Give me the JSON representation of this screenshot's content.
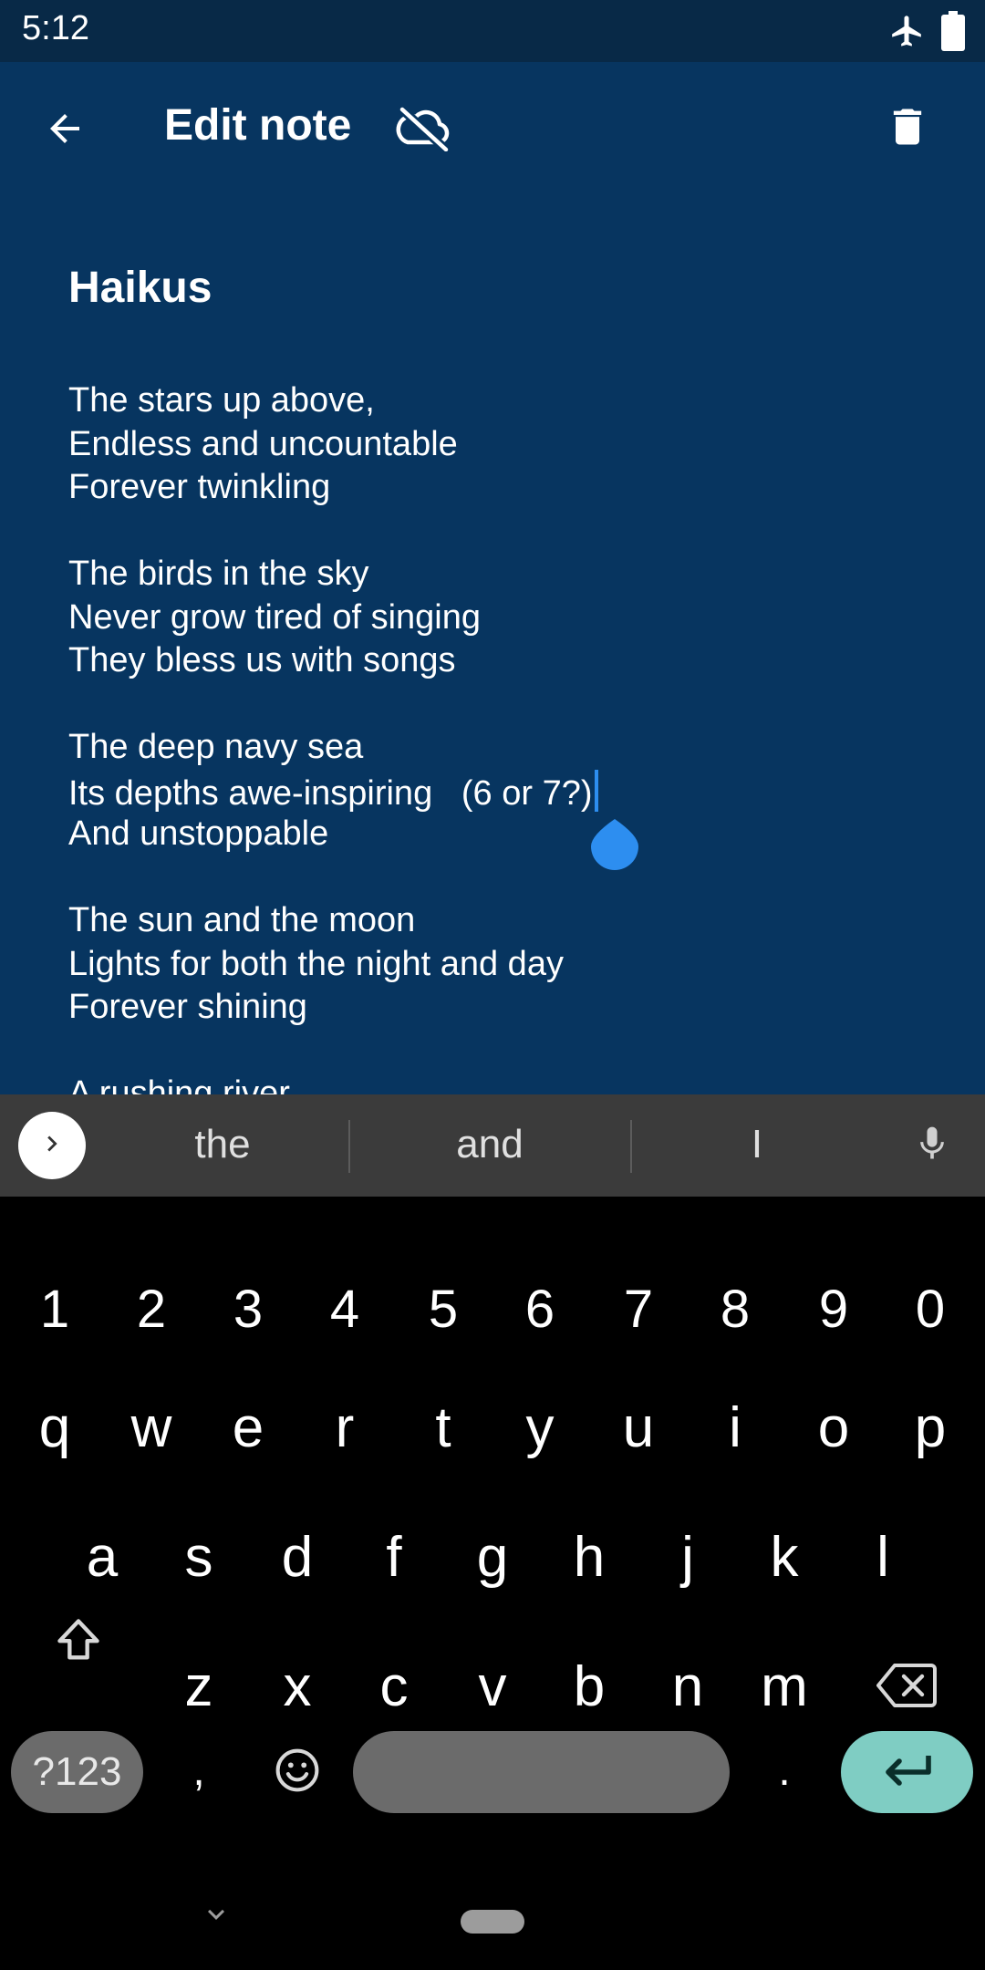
{
  "status_bar": {
    "time": "5:12",
    "icons": [
      "airplane-icon",
      "battery-icon"
    ]
  },
  "toolbar": {
    "title": "Edit note",
    "back_icon": "arrow-back-icon",
    "sync_icon": "cloud-off-icon",
    "delete_icon": "trash-icon"
  },
  "note": {
    "title": "Haikus",
    "stanzas": [
      [
        "The stars up above,",
        "Endless and uncountable",
        "Forever twinkling"
      ],
      [
        "The birds in the sky",
        "Never grow tired of singing",
        "They bless us with songs"
      ],
      [
        "The deep navy sea",
        "Its depths awe-inspiring   (6 or 7?)",
        "And unstoppable"
      ],
      [
        "The sun and the moon",
        "Lights for both the night and day",
        "Forever shining"
      ],
      [
        "A rushing river"
      ]
    ]
  },
  "suggestions": {
    "items": [
      "the",
      "and",
      "I"
    ]
  },
  "keyboard": {
    "number_row": [
      "1",
      "2",
      "3",
      "4",
      "5",
      "6",
      "7",
      "8",
      "9",
      "0"
    ],
    "row1": [
      "q",
      "w",
      "e",
      "r",
      "t",
      "y",
      "u",
      "i",
      "o",
      "p"
    ],
    "row2": [
      "a",
      "s",
      "d",
      "f",
      "g",
      "h",
      "j",
      "k",
      "l"
    ],
    "row3": [
      "z",
      "x",
      "c",
      "v",
      "b",
      "n",
      "m"
    ],
    "symbols_label": "?123",
    "comma": ",",
    "period": "."
  },
  "colors": {
    "app_background": "#073560",
    "status_bar": "#082947",
    "accent": "#2d8ef0",
    "enter_key": "#7fcdc3"
  }
}
